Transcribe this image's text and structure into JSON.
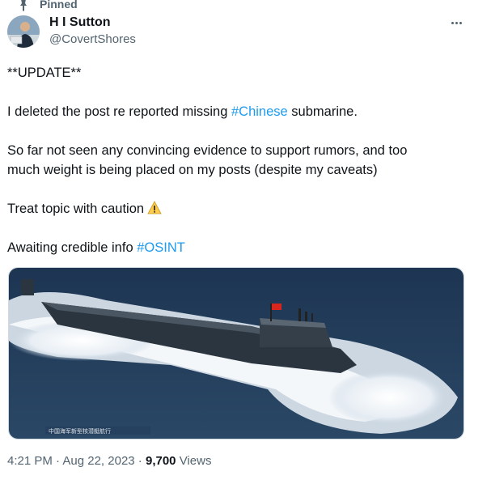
{
  "pinned_label": "Pinned",
  "author": {
    "name": "H I Sutton",
    "handle": "@CovertShores"
  },
  "tweet": {
    "line1": "**UPDATE**",
    "line2_pre": "I deleted the post re reported missing ",
    "line2_tag": "#Chinese",
    "line2_post": " submarine.",
    "line3": "So far not seen any convincing evidence to support rumors, and too",
    "line4": "much weight is being placed on my posts (despite my caveats)",
    "line5": "Treat topic with caution",
    "line6_pre": "Awaiting credible info ",
    "line6_tag": "#OSINT"
  },
  "image_caption": "中国海军新型核潜艇航行",
  "meta": {
    "time": "4:21 PM",
    "sep1": " · ",
    "date": "Aug 22, 2023",
    "sep2": " · ",
    "views_count": "9,700",
    "views_label": " Views"
  },
  "icons": [
    "pin-icon",
    "more-icon",
    "warning-icon"
  ],
  "colors": {
    "link": "#1d9bf0",
    "secondary": "#536471",
    "text": "#0f1419"
  }
}
